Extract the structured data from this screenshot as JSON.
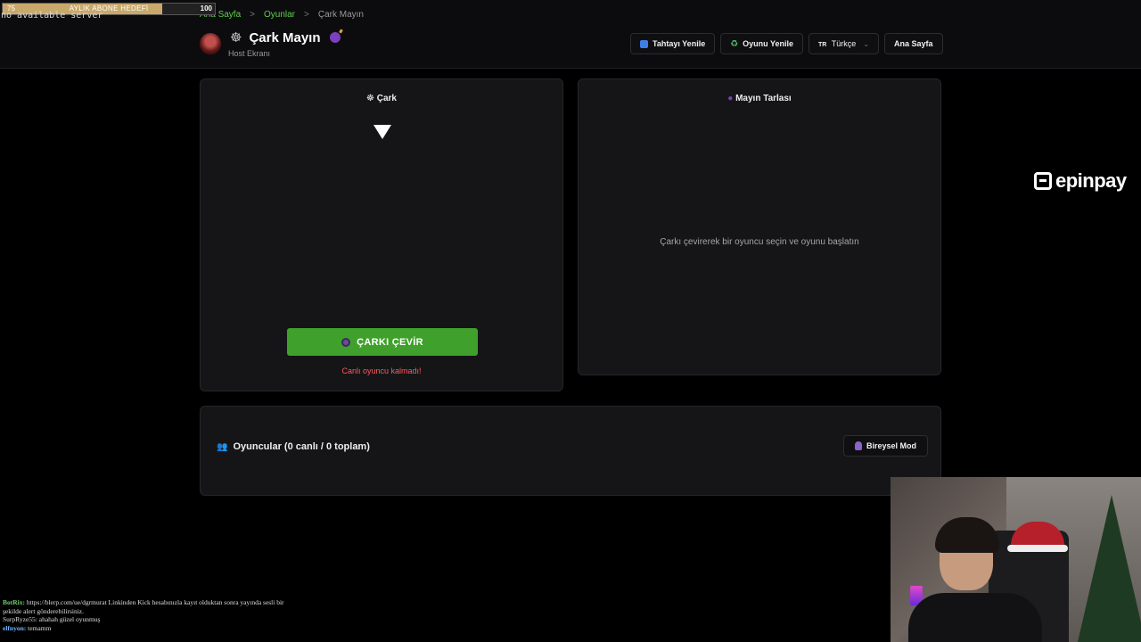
{
  "overlay": {
    "goal": {
      "start": "75",
      "title": "AYLIK ABONE HEDEFİ",
      "end": "100",
      "progress": 0.75
    },
    "no_server_text": "no available server"
  },
  "breadcrumb": {
    "home": "Ana Sayfa",
    "games": "Oyunlar",
    "current": "Çark Mayın",
    "separator": ">"
  },
  "header": {
    "title": "Çark Mayın",
    "subtitle": "Host Ekranı",
    "actions": {
      "refresh_board": "Tahtayı Yenile",
      "restart_game": "Oyunu Yenile",
      "language_flag": "TR",
      "language": "Türkçe",
      "home": "Ana Sayfa"
    }
  },
  "wheel_panel": {
    "title": "Çark",
    "spin_button": "ÇARKI ÇEVİR",
    "status": "Canlı oyuncu kalmadı!"
  },
  "mine_panel": {
    "title": "Mayın Tarlası",
    "hint": "Çarkı çevirerek bir oyuncu seçin ve oyunu başlatın"
  },
  "players_panel": {
    "title": "Oyuncular (0 canlı / 0 toplam)",
    "mode_button": "Bireysel Mod"
  },
  "sponsor": {
    "name": "epinpay"
  },
  "chat": [
    {
      "user": "BotRix:",
      "message": "https://blerp.com/ue/dgrmurat Linkinden Kick hesabınızla kayıt olduktan sonra yayında sesli bir şekilde alert gönderebilirsiniz."
    },
    {
      "user": "SurpRyze55:",
      "message": "ahahah güzel oyunmuş"
    },
    {
      "user": "elfnyon:",
      "message": "temamm"
    }
  ],
  "colors": {
    "accent_green": "#3fa12b",
    "link_green": "#5fcf4a",
    "error_red": "#ff5a5f",
    "purple": "#8a64c8"
  }
}
